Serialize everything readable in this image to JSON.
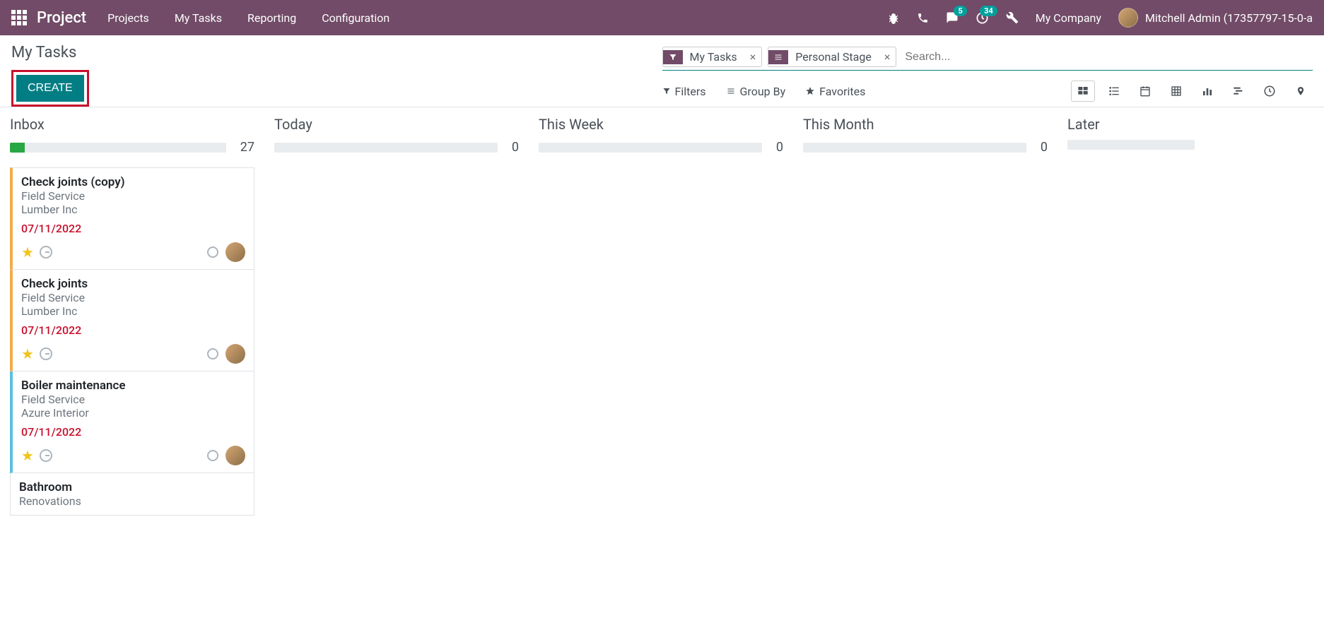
{
  "header": {
    "brand": "Project",
    "menu": [
      "Projects",
      "My Tasks",
      "Reporting",
      "Configuration"
    ],
    "messages_badge": "5",
    "activities_badge": "34",
    "company": "My Company",
    "user": "Mitchell Admin (17357797-15-0-a"
  },
  "page": {
    "title": "My Tasks",
    "create_label": "CREATE"
  },
  "search": {
    "facets": [
      {
        "icon": "filter",
        "label": "My Tasks"
      },
      {
        "icon": "group",
        "label": "Personal Stage"
      }
    ],
    "placeholder": "Search..."
  },
  "toolbar": {
    "filters": "Filters",
    "groupby": "Group By",
    "favorites": "Favorites"
  },
  "columns": [
    {
      "name": "Inbox",
      "count": "27",
      "fill": 7
    },
    {
      "name": "Today",
      "count": "0",
      "fill": 0
    },
    {
      "name": "This Week",
      "count": "0",
      "fill": 0
    },
    {
      "name": "This Month",
      "count": "0",
      "fill": 0
    },
    {
      "name": "Later",
      "count": "",
      "fill": 0
    }
  ],
  "cards": [
    {
      "title": "Check joints (copy)",
      "project": "Field Service",
      "client": "Lumber Inc",
      "date": "07/11/2022",
      "color": "orange"
    },
    {
      "title": "Check joints",
      "project": "Field Service",
      "client": "Lumber Inc",
      "date": "07/11/2022",
      "color": "orange"
    },
    {
      "title": "Boiler maintenance",
      "project": "Field Service",
      "client": "Azure Interior",
      "date": "07/11/2022",
      "color": "blue"
    },
    {
      "title": "Bathroom",
      "project": "Renovations",
      "client": "",
      "date": "",
      "color": "none"
    }
  ]
}
